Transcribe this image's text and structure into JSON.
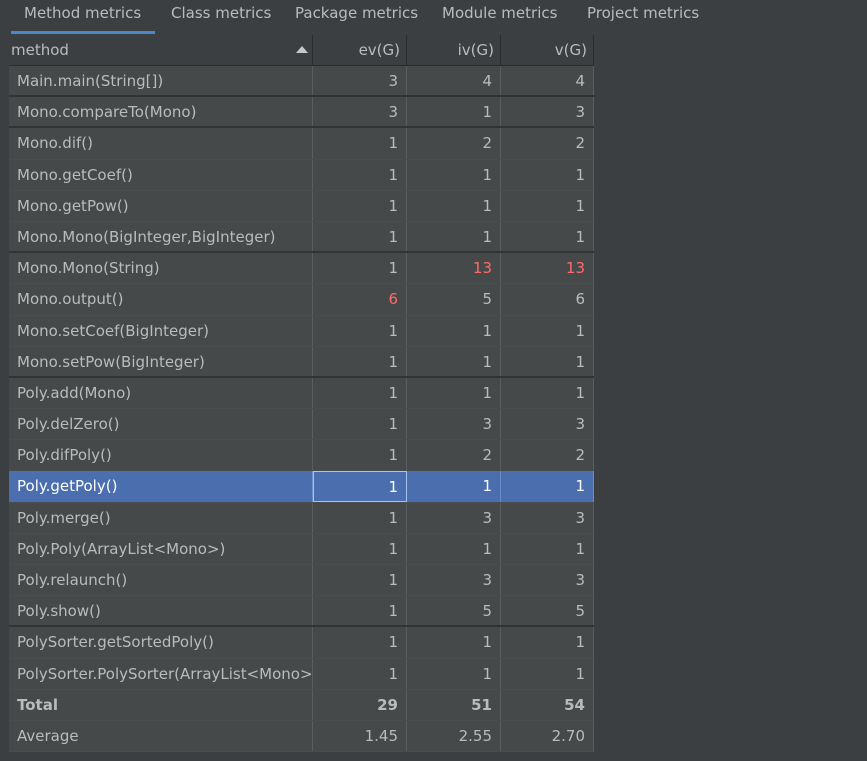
{
  "tabs": [
    {
      "label": "Method metrics",
      "active": true
    },
    {
      "label": "Class metrics",
      "active": false
    },
    {
      "label": "Package metrics",
      "active": false
    },
    {
      "label": "Module metrics",
      "active": false
    },
    {
      "label": "Project metrics",
      "active": false
    }
  ],
  "table": {
    "headers": [
      "method",
      "ev(G)",
      "iv(G)",
      "v(G)"
    ],
    "sort_icon": "sort-ascending-icon",
    "rows": [
      {
        "method": "Main.main(String[])",
        "ev": "3",
        "iv": "4",
        "v": "4"
      },
      {
        "method": "Mono.compareTo(Mono)",
        "ev": "3",
        "iv": "1",
        "v": "3"
      },
      {
        "method": "Mono.dif()",
        "ev": "1",
        "iv": "2",
        "v": "2"
      },
      {
        "method": "Mono.getCoef()",
        "ev": "1",
        "iv": "1",
        "v": "1"
      },
      {
        "method": "Mono.getPow()",
        "ev": "1",
        "iv": "1",
        "v": "1"
      },
      {
        "method": "Mono.Mono(BigInteger,BigInteger)",
        "ev": "1",
        "iv": "1",
        "v": "1"
      },
      {
        "method": "Mono.Mono(String)",
        "ev": "1",
        "iv": "13",
        "v": "13"
      },
      {
        "method": "Mono.output()",
        "ev": "6",
        "iv": "5",
        "v": "6"
      },
      {
        "method": "Mono.setCoef(BigInteger)",
        "ev": "1",
        "iv": "1",
        "v": "1"
      },
      {
        "method": "Mono.setPow(BigInteger)",
        "ev": "1",
        "iv": "1",
        "v": "1"
      },
      {
        "method": "Poly.add(Mono)",
        "ev": "1",
        "iv": "1",
        "v": "1"
      },
      {
        "method": "Poly.delZero()",
        "ev": "1",
        "iv": "3",
        "v": "3"
      },
      {
        "method": "Poly.difPoly()",
        "ev": "1",
        "iv": "2",
        "v": "2"
      },
      {
        "method": "Poly.getPoly()",
        "ev": "1",
        "iv": "1",
        "v": "1"
      },
      {
        "method": "Poly.merge()",
        "ev": "1",
        "iv": "3",
        "v": "3"
      },
      {
        "method": "Poly.Poly(ArrayList<Mono>)",
        "ev": "1",
        "iv": "1",
        "v": "1"
      },
      {
        "method": "Poly.relaunch()",
        "ev": "1",
        "iv": "3",
        "v": "3"
      },
      {
        "method": "Poly.show()",
        "ev": "1",
        "iv": "5",
        "v": "5"
      },
      {
        "method": "PolySorter.getSortedPoly()",
        "ev": "1",
        "iv": "1",
        "v": "1"
      },
      {
        "method": "PolySorter.PolySorter(ArrayList<Mono>)",
        "ev": "1",
        "iv": "1",
        "v": "1"
      }
    ],
    "total": {
      "label": "Total",
      "ev": "29",
      "iv": "51",
      "v": "54"
    },
    "average": {
      "label": "Average",
      "ev": "1.45",
      "iv": "2.55",
      "v": "2.70"
    }
  },
  "colors": {
    "background": "#3c3f41",
    "row": "#45494a",
    "selected_row": "#4b6eaf",
    "highlight": "#ff6b68",
    "tab_underline": "#4a88c7"
  }
}
